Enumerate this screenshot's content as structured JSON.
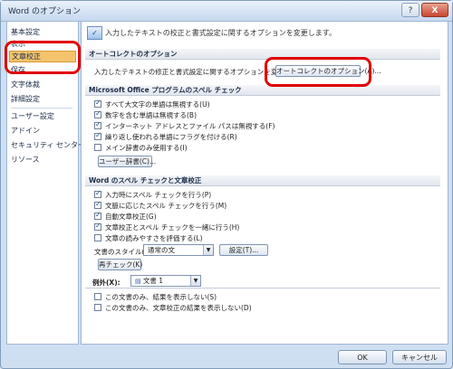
{
  "window": {
    "title": "Word のオプション",
    "help_label": "?",
    "close_label": "X"
  },
  "sidebar": {
    "items": [
      {
        "label": "基本設定"
      },
      {
        "label": "表示"
      },
      {
        "label": "文章校正"
      },
      {
        "label": "保存"
      },
      {
        "label": "文字体裁"
      },
      {
        "label": "詳細設定"
      },
      {
        "label": "ユーザー設定"
      },
      {
        "label": "アドイン"
      },
      {
        "label": "セキュリティ センター"
      },
      {
        "label": "リソース"
      }
    ]
  },
  "main": {
    "header": "入力したテキストの校正と書式設定に関するオプションを変更します。",
    "autocorrect": {
      "title": "オートコレクトのオプション",
      "description": "入力したテキストの修正と書式設定に関するオプションを変更します:",
      "button": "オートコレクトのオプション(A)..."
    },
    "office_spell": {
      "title": "Microsoft Office プログラムのスペル チェック",
      "options": [
        {
          "label": "すべて大文字の単語は無視する(U)",
          "checked": true
        },
        {
          "label": "数字を含む単語は無視する(B)",
          "checked": true
        },
        {
          "label": "インターネット アドレスとファイル パスは無視する(F)",
          "checked": true
        },
        {
          "label": "繰り返し使われる単語にフラグを付ける(R)",
          "checked": true
        },
        {
          "label": "メイン辞書のみ使用する(I)",
          "checked": false
        }
      ],
      "dictionary_button": "ユーザー辞書(C)..."
    },
    "word_spell": {
      "title": "Word のスペル チェックと文章校正",
      "options": [
        {
          "label": "入力時にスペル チェックを行う(P)",
          "checked": true
        },
        {
          "label": "文脈に応じたスペル チェックを行う(M)",
          "checked": true
        },
        {
          "label": "自動文章校正(G)",
          "checked": true
        },
        {
          "label": "文章校正とスペル チェックを一緒に行う(H)",
          "checked": true
        },
        {
          "label": "文章の読みやすさを評価する(L)",
          "checked": false
        }
      ],
      "style_label": "文書のスタイル(W):",
      "style_value": "通常の文",
      "settings_button": "設定(T)...",
      "recheck_button": "再チェック(K)"
    },
    "exceptions": {
      "title": "例外(X):",
      "document_value": "文書 1",
      "options": [
        {
          "label": "この文書のみ、結果を表示しない(S)",
          "checked": false
        },
        {
          "label": "この文書のみ、文章校正の結果を表示しない(D)",
          "checked": false
        }
      ]
    }
  },
  "footer": {
    "ok": "OK",
    "cancel": "キャンセル"
  },
  "colors": {
    "highlight": "#e00000",
    "selected_nav": "#f4c46c"
  }
}
